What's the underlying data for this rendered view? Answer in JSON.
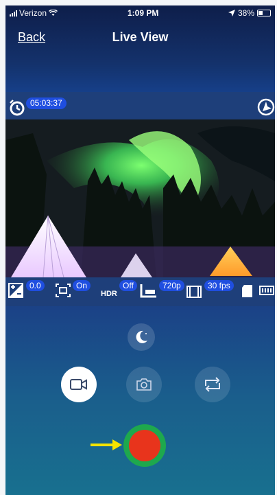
{
  "status_bar": {
    "carrier": "Verizon",
    "time": "1:09 PM",
    "battery": "38%"
  },
  "nav": {
    "back_label": "Back",
    "title": "Live View"
  },
  "timer": {
    "value": "05:03:37"
  },
  "settings": {
    "exposure": "0.0",
    "stabilization": "On",
    "hdr_label": "HDR",
    "hdr_value": "Off",
    "resolution": "720p",
    "framerate": "30 fps"
  },
  "controls": {
    "night_mode": "moon-icon",
    "video_mode": "video-camera-icon",
    "photo_mode": "camera-icon",
    "switch_camera": "swap-icon",
    "record": "record-button"
  },
  "colors": {
    "accent_pill": "#1f4ee0",
    "record_ring": "#1ea84d",
    "record_fill": "#e8341c",
    "arrow": "#f5e400"
  }
}
